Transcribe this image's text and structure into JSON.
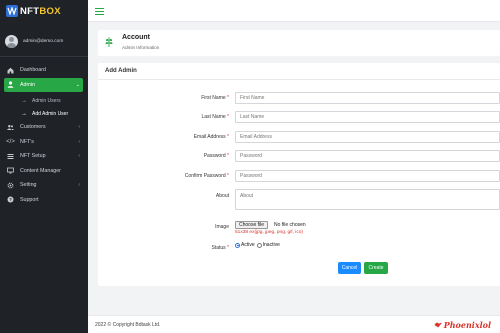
{
  "brand": {
    "name_main": "NFT",
    "name_accent": "BOX"
  },
  "user": {
    "email": "admin@demo.com"
  },
  "sidebar": {
    "items": [
      {
        "label": "Dashboard",
        "icon": "home-icon"
      },
      {
        "label": "Admin",
        "icon": "user-icon",
        "active": true
      },
      {
        "label": "Customers",
        "icon": "users-icon"
      },
      {
        "label": "NFT's",
        "icon": "code-icon"
      },
      {
        "label": "NFT Setup",
        "icon": "list-icon"
      },
      {
        "label": "Content Manager",
        "icon": "monitor-icon"
      },
      {
        "label": "Setting",
        "icon": "gear-icon"
      },
      {
        "label": "Support",
        "icon": "help-icon"
      }
    ],
    "admin_sub": [
      {
        "label": "Admin Users"
      },
      {
        "label": "Add Admin User",
        "current": true
      }
    ]
  },
  "header": {
    "title": "Account",
    "subtitle": "Admin Information"
  },
  "form": {
    "title": "Add Admin",
    "first_name": {
      "label": "First Name",
      "required": "*",
      "placeholder": "First Name"
    },
    "last_name": {
      "label": "Last Name",
      "required": "*",
      "placeholder": "Last Name"
    },
    "email": {
      "label": "Email Address",
      "required": "*",
      "placeholder": "Email Address"
    },
    "password": {
      "label": "Password",
      "required": "*",
      "placeholder": "Password"
    },
    "confirm_password": {
      "label": "Confirm Password",
      "required": "*",
      "placeholder": "Password"
    },
    "about": {
      "label": "About",
      "placeholder": "About"
    },
    "image": {
      "label": "Image",
      "button": "Choose file",
      "status": "No file chosen",
      "hint": "51x38 ex(jpg, jpeg, png, gif, ico)"
    },
    "status": {
      "label": "Status",
      "required": "*",
      "options": [
        "Active",
        "Inactive"
      ],
      "selected": "Active"
    },
    "cancel_label": "Cancel",
    "create_label": "Create"
  },
  "footer": {
    "copyright": "2022 © Copyright Bdtask Ltd.",
    "logo_text": "Phoenixlol"
  },
  "colors": {
    "accent": "#27a745",
    "sidebar": "#1f2328",
    "link_blue": "#1a8cff",
    "required": "#d9342b"
  }
}
